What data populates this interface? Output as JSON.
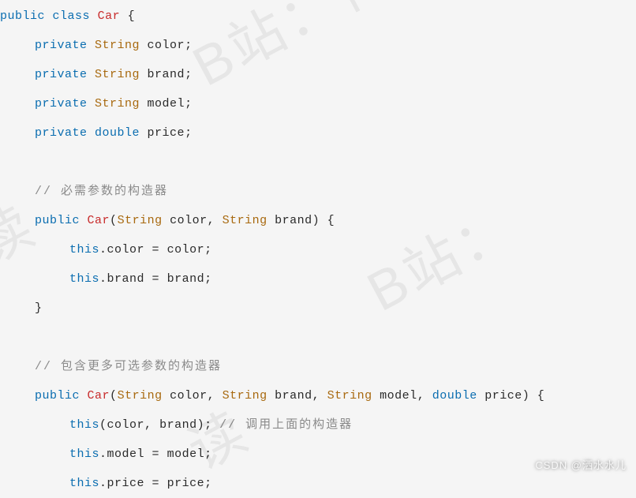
{
  "code": {
    "l1_public": "public",
    "l1_class": "class",
    "l1_name": "Car",
    "l1_brace": " {",
    "l2_private": "private",
    "l2_type": "String",
    "l2_ident": " color",
    "l2_semi": ";",
    "l3_private": "private",
    "l3_type": "String",
    "l3_ident": " brand",
    "l3_semi": ";",
    "l4_private": "private",
    "l4_type": "String",
    "l4_ident": " model",
    "l4_semi": ";",
    "l5_private": "private",
    "l5_type": "double",
    "l5_ident": " price",
    "l5_semi": ";",
    "c1": "// 必需参数的构造器",
    "l7_public": "public",
    "l7_name": "Car",
    "l7_p1": "(",
    "l7_t1": "String",
    "l7_a1": " color",
    "l7_comma1": ", ",
    "l7_t2": "String",
    "l7_a2": " brand",
    "l7_p2": ")",
    "l7_brace": " {",
    "l8_this": "this",
    "l8_dot": ".",
    "l8_f": "color",
    "l8_eq": " = ",
    "l8_v": "color",
    "l8_semi": ";",
    "l9_this": "this",
    "l9_dot": ".",
    "l9_f": "brand",
    "l9_eq": " = ",
    "l9_v": "brand",
    "l9_semi": ";",
    "l10_close": "}",
    "c2": "// 包含更多可选参数的构造器",
    "l12_public": "public",
    "l12_name": "Car",
    "l12_p1": "(",
    "l12_t1": "String",
    "l12_a1": " color",
    "l12_c1": ", ",
    "l12_t2": "String",
    "l12_a2": " brand",
    "l12_c2": ", ",
    "l12_t3": "String",
    "l12_a3": " model",
    "l12_c3": ", ",
    "l12_t4": "double",
    "l12_a4": " price",
    "l12_p2": ")",
    "l12_brace": " {",
    "l13_this": "this",
    "l13_p1": "(",
    "l13_a1": "color",
    "l13_c1": ", ",
    "l13_a2": "brand",
    "l13_p2": ")",
    "l13_semi": ";",
    "l13_sp": " ",
    "l13_comment": "// 调用上面的构造器",
    "l14_this": "this",
    "l14_dot": ".",
    "l14_f": "model",
    "l14_eq": " = ",
    "l14_v": "model",
    "l14_semi": ";",
    "l15_this": "this",
    "l15_dot": ".",
    "l15_f": "price",
    "l15_eq": " = ",
    "l15_v": "price",
    "l15_semi": ";"
  },
  "watermarks": {
    "w1": "B站：代码",
    "w2": "读",
    "w3": "B站：",
    "w4": "读"
  },
  "credit": "CSDN @洒水水儿"
}
